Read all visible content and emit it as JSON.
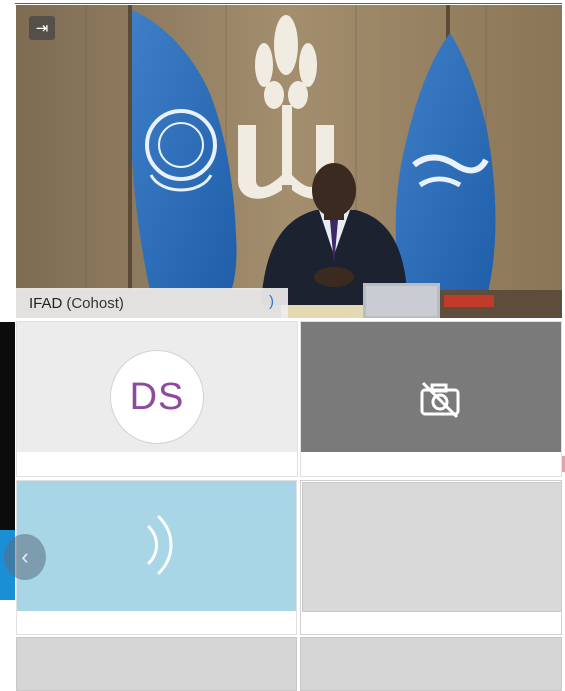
{
  "main_tile": {
    "participant_name": "IFAD",
    "participant_role": "(Cohost)"
  },
  "tiles": [
    {
      "initials": "DS",
      "state": "no-video-avatar"
    },
    {
      "state": "camera-off",
      "icon": "camera-off-icon"
    },
    {
      "state": "speaking",
      "icon": "speaking-indicator-icon"
    },
    {
      "state": "blank"
    }
  ],
  "colors": {
    "avatar_initials": "#8d4a9e",
    "speaking_tile": "#a9d6e7",
    "camera_off_tile": "#7a7a7a",
    "top_rule": "#2b63c6"
  }
}
